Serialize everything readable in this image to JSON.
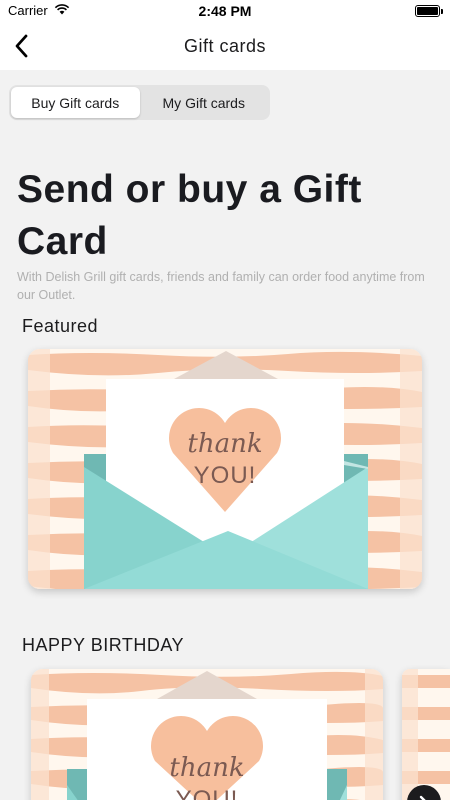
{
  "status_bar": {
    "carrier": "Carrier",
    "time": "2:48 PM",
    "battery_level": 1.0
  },
  "nav": {
    "title": "Gift cards",
    "back_icon": "chevron-left-icon"
  },
  "tabs": [
    {
      "label": "Buy Gift cards",
      "selected": true
    },
    {
      "label": "My Gift cards",
      "selected": false
    }
  ],
  "hero": {
    "title_line1": "Send or buy a Gift",
    "title_line2": "Card",
    "subtitle": "With Delish Grill gift cards, friends and family can order food anytime from our Outlet."
  },
  "sections": [
    {
      "label": "Featured",
      "cards": [
        {
          "line1": "thank",
          "line2": "YOU!"
        }
      ]
    },
    {
      "label": "HAPPY BIRTHDAY",
      "cards": [
        {
          "line1": "thank",
          "line2": "YOU!"
        }
      ]
    }
  ],
  "colors": {
    "stripe": "#f5c2a4",
    "background": "#fff7ee",
    "envelope": "#8fd8d3",
    "heart": "#f7bf9d",
    "text": "#1a1b20"
  }
}
